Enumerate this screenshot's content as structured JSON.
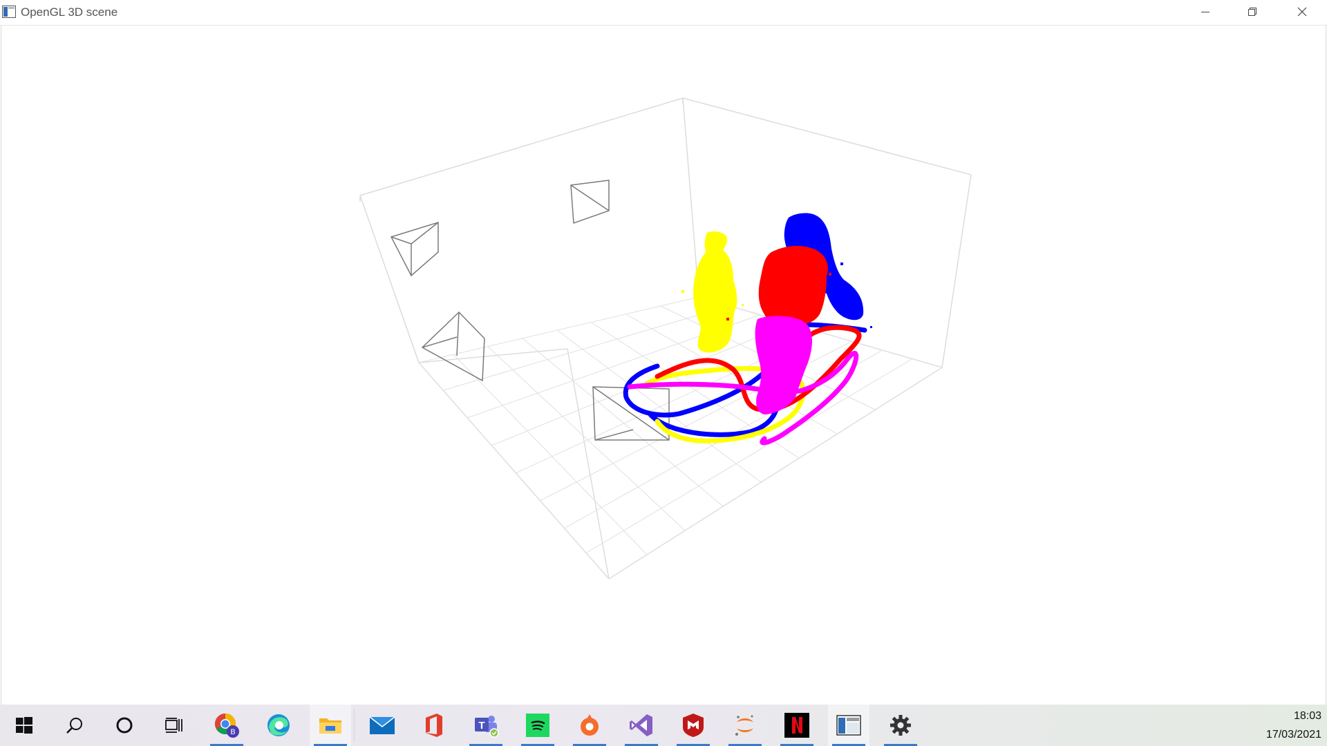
{
  "window": {
    "title": "OpenGL 3D scene",
    "controls": [
      "minimize",
      "restore",
      "close"
    ]
  },
  "scene": {
    "background": "#ffffff",
    "grid_color": "#d9d9d9",
    "camera_frustum_color": "#7a7a7a",
    "camera_count": 5,
    "point_cloud_colors": [
      "#ffff00",
      "#ff0000",
      "#0000ff",
      "#ff00ff"
    ],
    "trajectory_colors": [
      "#0000ff",
      "#ffff00",
      "#ff0000",
      "#ff00ff"
    ]
  },
  "taskbar": {
    "items": [
      {
        "name": "start",
        "icon": "windows-logo-icon",
        "pinned": true,
        "running": false
      },
      {
        "name": "search",
        "icon": "search-icon",
        "pinned": true,
        "running": false
      },
      {
        "name": "cortana",
        "icon": "cortana-circle-icon",
        "pinned": true,
        "running": false
      },
      {
        "name": "task-view",
        "icon": "task-view-icon",
        "pinned": true,
        "running": false
      },
      {
        "name": "chrome",
        "icon": "chrome-icon",
        "badge": "B",
        "running": true
      },
      {
        "name": "edge",
        "icon": "edge-icon",
        "running": false
      },
      {
        "name": "file-explorer",
        "icon": "folder-icon",
        "running": true,
        "active": true
      },
      {
        "name": "mail",
        "icon": "mail-icon",
        "running": false
      },
      {
        "name": "office",
        "icon": "office-icon",
        "running": false
      },
      {
        "name": "teams",
        "icon": "teams-icon",
        "running": true
      },
      {
        "name": "spotify",
        "icon": "spotify-icon",
        "running": true
      },
      {
        "name": "origin",
        "icon": "origin-icon",
        "running": true
      },
      {
        "name": "visual-studio",
        "icon": "visual-studio-icon",
        "running": true
      },
      {
        "name": "mcafee",
        "icon": "mcafee-icon",
        "running": true
      },
      {
        "name": "jupyter",
        "icon": "jupyter-icon",
        "running": true
      },
      {
        "name": "netflix",
        "icon": "netflix-icon",
        "running": true
      },
      {
        "name": "opengl-window",
        "icon": "opengl-window-icon",
        "running": true
      },
      {
        "name": "settings",
        "icon": "gear-icon",
        "running": true
      }
    ],
    "clock": {
      "time": "18:03",
      "date": "17/03/2021"
    },
    "colors": {
      "running_indicator": "#3a78c9",
      "netflix_red": "#e50914",
      "spotify_green": "#1ed760"
    }
  }
}
